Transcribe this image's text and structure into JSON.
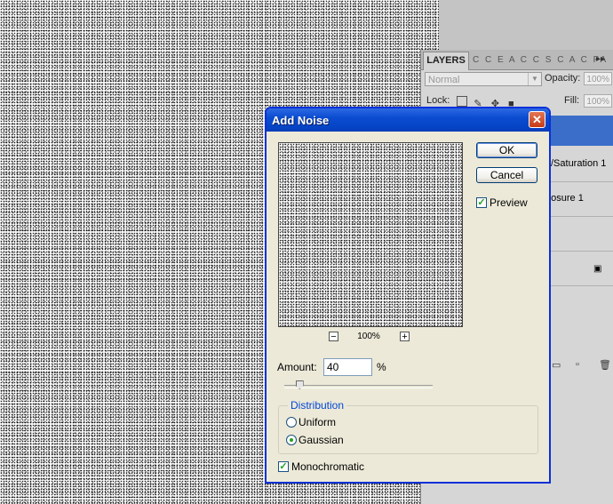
{
  "canvas": {
    "description": "noise-filled image canvas"
  },
  "layers_panel": {
    "active_tab": "LAYERS",
    "other_tabs": "C C E A C C S C A C PA",
    "menu_arrows": "▸▸",
    "blend_mode": "Normal",
    "opacity_label": "Opacity:",
    "opacity_value": "100%",
    "lock_label": "Lock:",
    "fill_label": "Fill:",
    "fill_value": "100%",
    "layers": [
      {
        "name": "/Saturation 1"
      },
      {
        "name": "posure 1"
      },
      {
        "name": ""
      },
      {
        "name": ""
      }
    ]
  },
  "dialog": {
    "title": "Add Noise",
    "close_glyph": "✕",
    "ok_label": "OK",
    "cancel_label": "Cancel",
    "preview_label": "Preview",
    "preview_checked": true,
    "zoom_minus": "−",
    "zoom_plus": "+",
    "zoom_value": "100%",
    "amount_label": "Amount:",
    "amount_value": "40",
    "amount_unit": "%",
    "amount_fraction": 0.1,
    "distribution_label": "Distribution",
    "distribution_options": [
      "Uniform",
      "Gaussian"
    ],
    "distribution_selected": "Gaussian",
    "monochromatic_label": "Monochromatic",
    "monochromatic_checked": true,
    "accent_color": "#0831d9",
    "selection_color": "#3a6ec9"
  }
}
